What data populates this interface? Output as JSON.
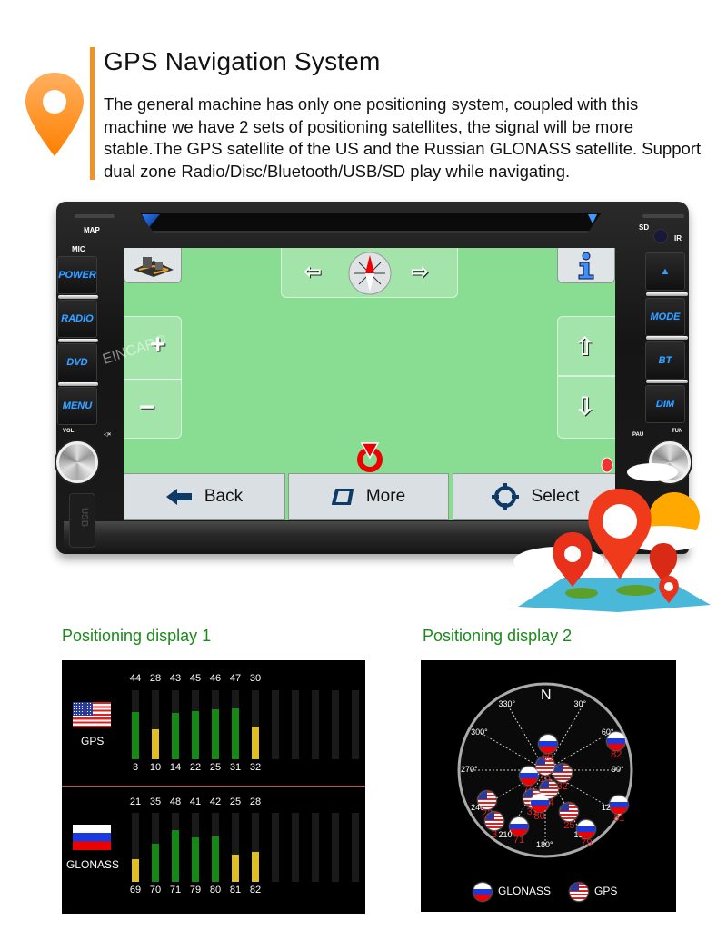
{
  "header": {
    "title": "GPS Navigation System",
    "description": "The general machine has only one positioning system, coupled with this machine we have 2 sets of positioning satellites, the signal will be more stable.The GPS satellite of the US and the Russian GLONASS satellite. Support dual zone Radio/Disc/Bluetooth/USB/SD play while navigating.",
    "accent_color": "#f39224"
  },
  "device": {
    "labels": {
      "map": "MAP",
      "mic": "MIC",
      "sd": "SD",
      "ir": "IR",
      "vol": "VOL",
      "mute": "◁×",
      "pau": "PAU",
      "tun": "TUN",
      "usb": "USB"
    },
    "left_buttons": [
      "POWER",
      "RADIO",
      "DVD",
      "MENU"
    ],
    "right_buttons": [
      "▲",
      "MODE",
      "BT",
      "DIM"
    ],
    "watermark": "EINCAR®"
  },
  "screen": {
    "background": "#88dd92",
    "top_arrows": {
      "left": "⇦",
      "right": "⇨"
    },
    "zoom": {
      "in": "+",
      "out": "−"
    },
    "pan": {
      "up": "⇧",
      "down": "⇩"
    },
    "bottom_buttons": [
      {
        "label": "Back",
        "icon": "back-arrow-icon"
      },
      {
        "label": "More",
        "icon": "more-icon"
      },
      {
        "label": "Select",
        "icon": "crosshair-icon"
      }
    ]
  },
  "display1": {
    "label": "Positioning display 1",
    "gps": {
      "name": "GPS",
      "snr": [
        44,
        28,
        43,
        45,
        46,
        47,
        30
      ],
      "ids": [
        3,
        10,
        14,
        22,
        25,
        31,
        32
      ],
      "empty_slots": 5
    },
    "glonass": {
      "name": "GLONASS",
      "snr": [
        21,
        35,
        48,
        41,
        42,
        25,
        28
      ],
      "ids": [
        69,
        70,
        71,
        79,
        80,
        81,
        82
      ],
      "empty_slots": 5
    },
    "colors": {
      "strong": "#138a13",
      "weak": "#e0c020"
    },
    "max_snr": 64,
    "weak_threshold": 30
  },
  "display2": {
    "label": "Positioning display 2",
    "north": "N",
    "degree_labels": [
      "330°",
      "30°",
      "300°",
      "60°",
      "270°",
      "90°",
      "240°",
      "120°",
      "210°",
      "150°",
      "180°"
    ],
    "satellites": [
      {
        "id": "10",
        "type": "us",
        "az": 358,
        "el": 85
      },
      {
        "id": "69",
        "type": "ru",
        "az": 5,
        "el": 62
      },
      {
        "id": "82",
        "type": "ru",
        "az": 68,
        "el": 10
      },
      {
        "id": "32",
        "type": "us",
        "az": 100,
        "el": 72
      },
      {
        "id": "70",
        "type": "ru",
        "az": 250,
        "el": 72
      },
      {
        "id": "14",
        "type": "us",
        "az": 170,
        "el": 70
      },
      {
        "id": "22",
        "type": "us",
        "az": 243,
        "el": 22
      },
      {
        "id": "31",
        "type": "us",
        "az": 205,
        "el": 58
      },
      {
        "id": "80",
        "type": "ru",
        "az": 190,
        "el": 55
      },
      {
        "id": "25",
        "type": "us",
        "az": 150,
        "el": 40
      },
      {
        "id": "81",
        "type": "ru",
        "az": 115,
        "el": 5
      },
      {
        "id": "3",
        "type": "us",
        "az": 225,
        "el": 15
      },
      {
        "id": "71",
        "type": "ru",
        "az": 205,
        "el": 25
      },
      {
        "id": "79",
        "type": "ru",
        "az": 145,
        "el": 15
      }
    ],
    "legend": [
      {
        "type": "ru",
        "label": "GLONASS"
      },
      {
        "type": "us",
        "label": "GPS"
      }
    ]
  }
}
